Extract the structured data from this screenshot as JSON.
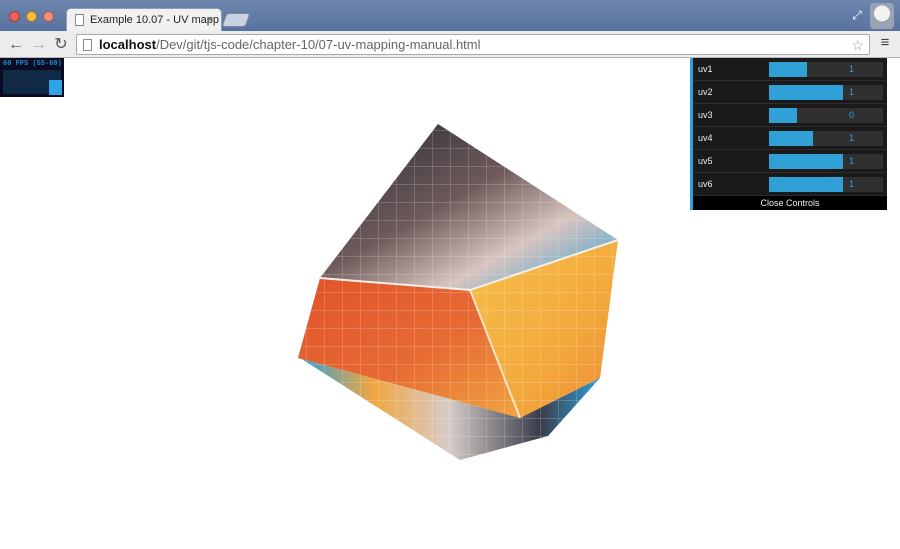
{
  "browser": {
    "tab_title": "Example 10.07 - UV mapp",
    "url_host": "localhost",
    "url_path": "/Dev/git/tjs-code/chapter-10/07-uv-mapping-manual.html"
  },
  "stats": {
    "fps_label": "60 FPS (55-60)"
  },
  "controls": {
    "sliders": [
      {
        "label": "uv1",
        "value": "1",
        "fill": 0.52
      },
      {
        "label": "uv2",
        "value": "1",
        "fill": 1.0
      },
      {
        "label": "uv3",
        "value": "0",
        "fill": 0.38
      },
      {
        "label": "uv4",
        "value": "1",
        "fill": 0.6
      },
      {
        "label": "uv5",
        "value": "1",
        "fill": 1.0
      },
      {
        "label": "uv6",
        "value": "1",
        "fill": 1.0
      }
    ],
    "close_label": "Close Controls"
  },
  "colors": {
    "accent": "#2fa1d6",
    "panel_bg": "#1a1a1a",
    "cube_orange": "#e0532b",
    "cube_yellow": "#f4b740",
    "cube_dark": "#2c2f3b",
    "cube_blue": "#2fa1d6"
  },
  "icons": {
    "back": "arrow-left-icon",
    "forward": "arrow-right-icon",
    "reload": "reload-icon",
    "star": "star-icon",
    "menu": "hamburger-menu-icon"
  }
}
